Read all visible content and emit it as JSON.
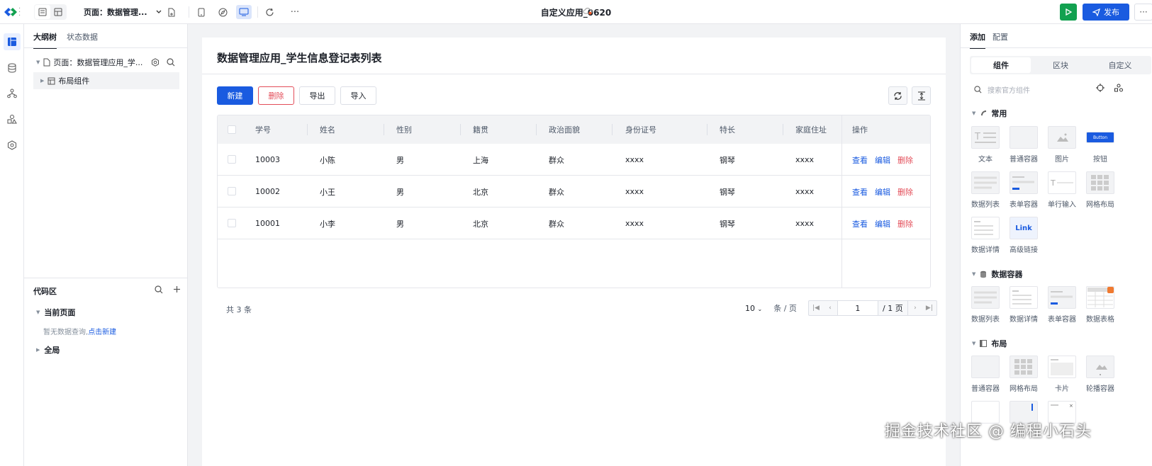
{
  "app": {
    "title": "自定义应用_0620",
    "publish_label": "发布",
    "page_select": "页面：数据管理..."
  },
  "left_panel": {
    "tabs": [
      "大纲树",
      "状态数据"
    ],
    "tree": {
      "page_label": "页面：数据管理应用_学...",
      "layout_label": "布局组件"
    },
    "code": {
      "title": "代码区",
      "current_page": "当前页面",
      "empty_text": "暂无数据查询,",
      "empty_link": "点击新建",
      "global": "全局"
    }
  },
  "canvas": {
    "title": "数据管理应用_学生信息登记表列表",
    "buttons": {
      "new": "新建",
      "delete": "删除",
      "export": "导出",
      "import": "导入"
    },
    "table": {
      "columns": [
        "学号",
        "姓名",
        "性别",
        "籍贯",
        "政治面貌",
        "身份证号",
        "特长",
        "家庭住址",
        "操作"
      ],
      "rows": [
        [
          "10003",
          "小陈",
          "男",
          "上海",
          "群众",
          "xxxx",
          "钢琴",
          "xxxx"
        ],
        [
          "10002",
          "小王",
          "男",
          "北京",
          "群众",
          "xxxx",
          "钢琴",
          "xxxx"
        ],
        [
          "10001",
          "小李",
          "男",
          "北京",
          "群众",
          "xxxx",
          "钢琴",
          "xxxx"
        ]
      ],
      "actions": {
        "view": "查看",
        "edit": "编辑",
        "delete": "删除"
      }
    },
    "pagination": {
      "total": "共 3 条",
      "page_size": "10",
      "per_page": "条 / 页",
      "current": "1",
      "of_pages": "/ 1 页"
    }
  },
  "right_panel": {
    "tabs": [
      "添加",
      "配置"
    ],
    "segments": [
      "组件",
      "区块",
      "自定义"
    ],
    "search_placeholder": "搜索官方组件",
    "sections": {
      "common": "常用",
      "data_container": "数据容器",
      "layout": "布局"
    },
    "common_items": [
      "文本",
      "普通容器",
      "图片",
      "按钮",
      "数据列表",
      "表单容器",
      "单行输入",
      "网格布局",
      "数据详情",
      "高级链接"
    ],
    "button_thumb_text": "Button",
    "link_thumb_text": "Link",
    "data_items": [
      "数据列表",
      "数据详情",
      "表单容器",
      "数据表格"
    ],
    "layout_items": [
      "普通容器",
      "网格布局",
      "卡片",
      "轮播容器"
    ]
  },
  "watermark": "掘金技术社区 @ 编程小石头",
  "colors": {
    "primary": "#1a5be0",
    "danger": "#e34d59",
    "success": "#12a150"
  }
}
